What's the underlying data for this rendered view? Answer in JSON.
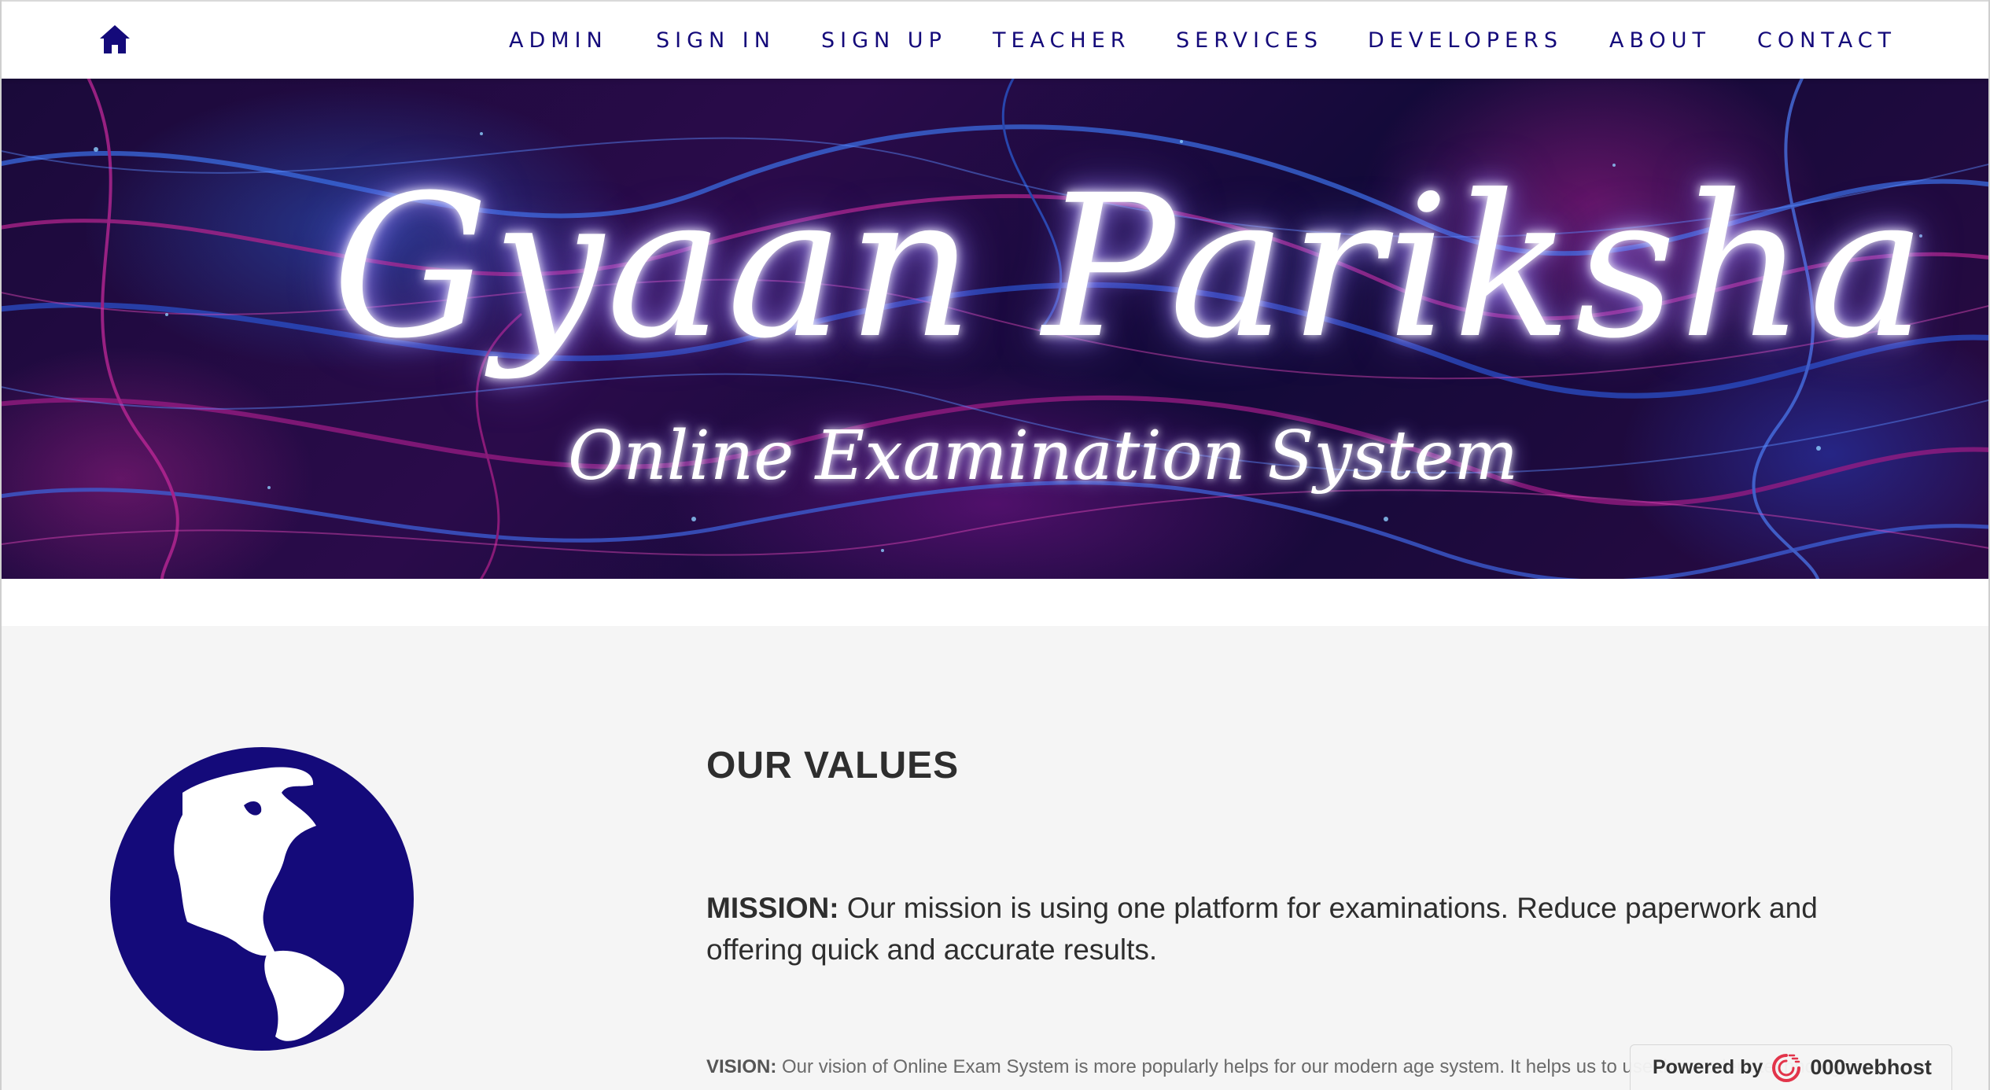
{
  "navbar": {
    "home_icon": "home-icon",
    "links": [
      {
        "label": "ADMIN"
      },
      {
        "label": "SIGN IN"
      },
      {
        "label": "SIGN UP"
      },
      {
        "label": "TEACHER"
      },
      {
        "label": "SERVICES"
      },
      {
        "label": "DEVELOPERS"
      },
      {
        "label": "ABOUT"
      },
      {
        "label": "CONTACT"
      }
    ]
  },
  "hero": {
    "title": "Gyaan Pariksha",
    "subtitle": "Online Examination System"
  },
  "values": {
    "heading": "OUR VALUES",
    "globe_icon": "globe-americas-icon",
    "mission_label": "MISSION:",
    "mission_text": " Our mission is using one platform for examinations. Reduce paperwork and offering quick and accurate results.",
    "vision_label": "VISION:",
    "vision_text": " Our vision of Online Exam System is more popularly helps for our modern age system. It helps us to use the modern technology"
  },
  "badge": {
    "powered_by": "Powered by",
    "brand": "000webhost"
  },
  "colors": {
    "accent": "#140a7a",
    "section_bg": "#f5f5f5",
    "text_dark": "#2e2e2e",
    "text_muted": "#6a6a6a"
  }
}
